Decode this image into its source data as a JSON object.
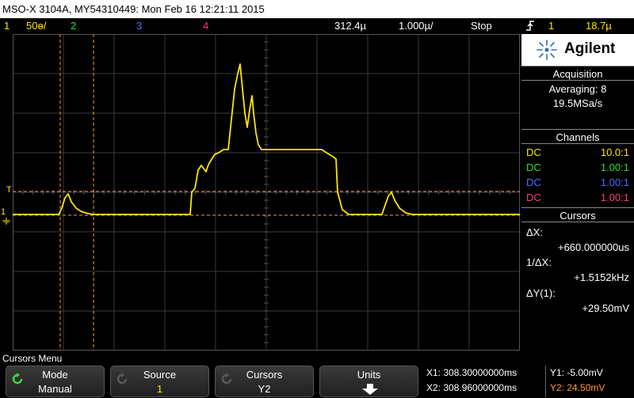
{
  "title": "MSO-X 3104A, MY54310449: Mon Feb 16 12:21:11 2015",
  "status": {
    "ch1_num": "1",
    "ch1_scale": "50ɵ/",
    "ch2_num": "2",
    "ch3_num": "3",
    "ch4_num": "4",
    "delay": "312.4µ",
    "timebase": "1.000µ/",
    "run_state": "Stop",
    "trig_icon": "trigger-edge-icon",
    "trig_src": "1",
    "trig_level": "18.7µ"
  },
  "colors": {
    "ch1": "#ffe600",
    "ch2": "#3adb3a",
    "ch3": "#4f6dff",
    "ch4": "#ff3b7a",
    "cursor": "#ff9a2e"
  },
  "markers": {
    "trigger": "T",
    "ch1_ground": "1"
  },
  "panel": {
    "brand": "Agilent",
    "acquisition_head": "Acquisition",
    "averaging": "Averaging: 8",
    "sample_rate": "19.5MSa/s",
    "channels_head": "Channels",
    "channels": [
      {
        "coupling": "DC",
        "ratio": "10.0:1"
      },
      {
        "coupling": "DC",
        "ratio": "1.00:1"
      },
      {
        "coupling": "DC",
        "ratio": "1.00:1"
      },
      {
        "coupling": "DC",
        "ratio": "1.00:1"
      }
    ],
    "cursors_head": "Cursors",
    "dx_label": "ΔX:",
    "dx_value": "+660.000000us",
    "inv_dx_label": "1/ΔX:",
    "inv_dx_value": "+1.5152kHz",
    "dy_label": "ΔY(1):",
    "dy_value": "+29.50mV"
  },
  "menu": {
    "label": "Cursors Menu",
    "softkeys": [
      {
        "top": "Mode",
        "bottom": "Manual"
      },
      {
        "top": "Source",
        "bottom": "1"
      },
      {
        "top": "Cursors",
        "bottom": "Y2"
      },
      {
        "top": "Units",
        "bottom": ""
      }
    ]
  },
  "readout": {
    "x1": "X1: 308.30000000ms",
    "x2": "X2: 308.96000000ms",
    "y1": "Y1: -5.00mV",
    "y2": "Y2: 24.50mV"
  }
}
